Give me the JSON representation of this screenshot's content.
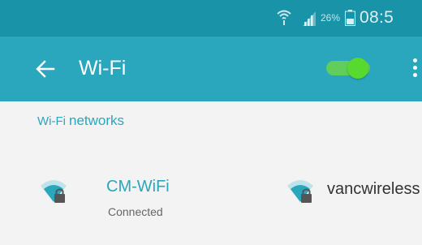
{
  "status_bar": {
    "battery_percent": "26%",
    "time": "08:5",
    "icons": [
      "wifi-icon",
      "signal-icon",
      "battery-icon"
    ]
  },
  "app_bar": {
    "back_icon": "arrow-left-icon",
    "title": "Wi-Fi",
    "toggle_state": "on",
    "more_icon": "more-vertical-icon"
  },
  "content": {
    "section_header_prefix": "Wi-Fi",
    "section_header_suffix": "networks",
    "networks": [
      {
        "name": "CM-WiFi",
        "status": "Connected",
        "icon": "wifi-lock-icon",
        "color": "#2aa6bd"
      },
      {
        "name": "vancwireless",
        "status": "",
        "icon": "wifi-lock-icon",
        "color": "#333333"
      }
    ]
  },
  "colors": {
    "status_bar": "#1993a8",
    "app_bar": "#2aa6bd",
    "accent": "#2aa6bd",
    "toggle": "#58d92f",
    "background": "#f3f3f3"
  }
}
